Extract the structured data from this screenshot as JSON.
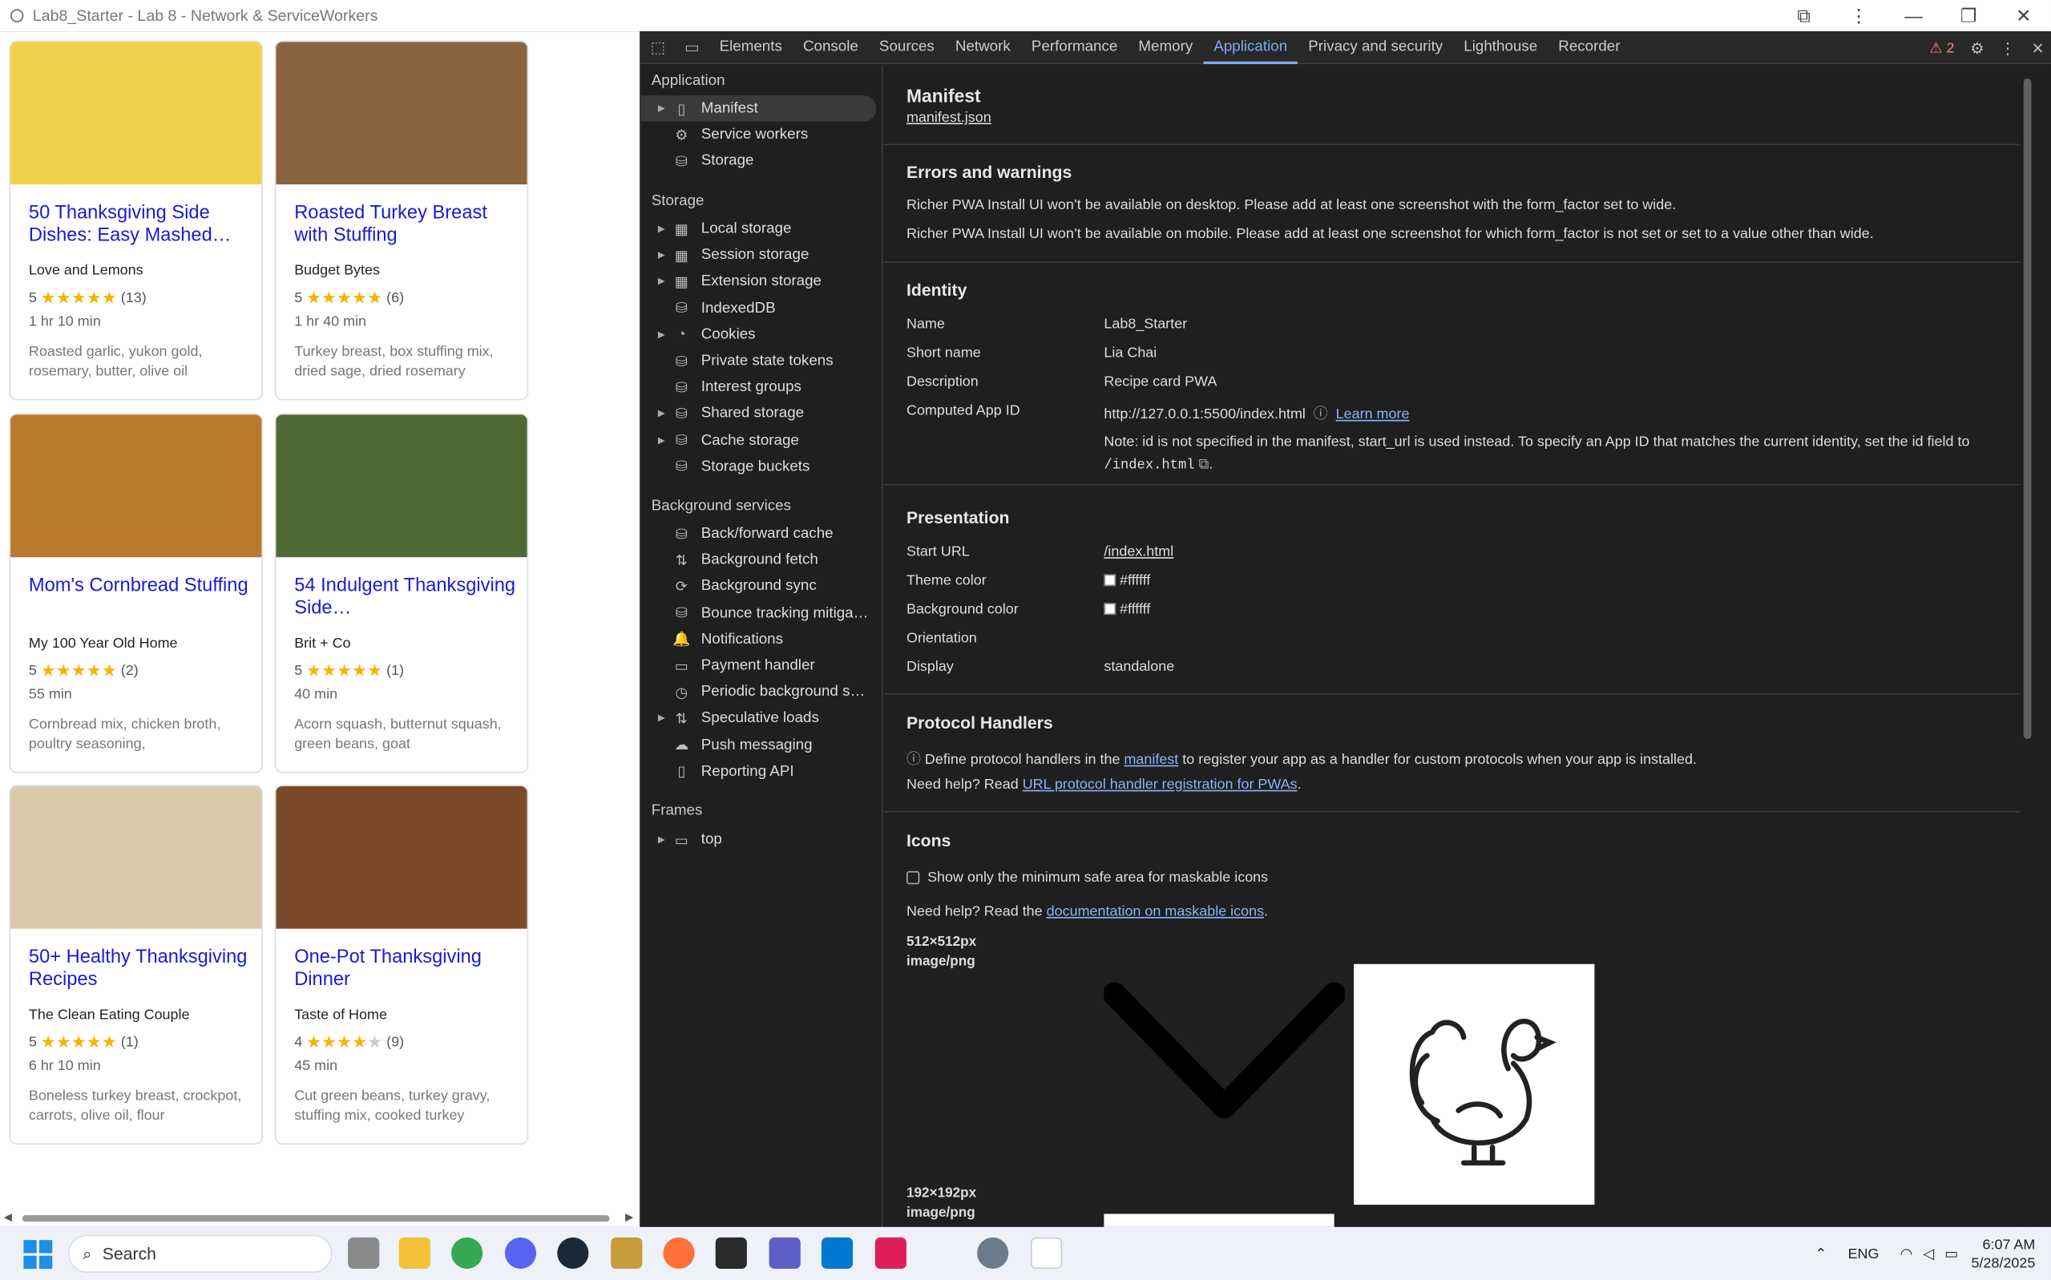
{
  "window": {
    "title": "Lab8_Starter - Lab 8 - Network & ServiceWorkers"
  },
  "recipes": [
    {
      "title": "50 Thanksgiving Side Dishes: Easy Mashed…",
      "source": "Love and Lemons",
      "rating_num": "5",
      "stars": 5,
      "reviews": "(13)",
      "time": "1 hr 10 min",
      "ingredients": "Roasted garlic, yukon gold, rosemary, butter, olive oil",
      "img_color": "#f0d24a"
    },
    {
      "title": "Roasted Turkey Breast with Stuffing",
      "source": "Budget Bytes",
      "rating_num": "5",
      "stars": 5,
      "reviews": "(6)",
      "time": "1 hr 40 min",
      "ingredients": "Turkey breast, box stuffing mix, dried sage, dried rosemary",
      "img_color": "#8a6440"
    },
    {
      "title": "Mom's Cornbread Stuffing",
      "source": "My 100 Year Old Home",
      "rating_num": "5",
      "stars": 5,
      "reviews": "(2)",
      "time": "55 min",
      "ingredients": "Cornbread mix, chicken broth, poultry seasoning,",
      "img_color": "#b97a2e"
    },
    {
      "title": "54 Indulgent Thanksgiving Side…",
      "source": "Brit + Co",
      "rating_num": "5",
      "stars": 5,
      "reviews": "(1)",
      "time": "40 min",
      "ingredients": "Acorn squash, butternut squash, green beans, goat",
      "img_color": "#4d6a34"
    },
    {
      "title": "50+ Healthy Thanksgiving Recipes",
      "source": "The Clean Eating Couple",
      "rating_num": "5",
      "stars": 5,
      "reviews": "(1)",
      "time": "6 hr 10 min",
      "ingredients": "Boneless turkey breast, crockpot, carrots, olive oil, flour",
      "img_color": "#d8c9a8"
    },
    {
      "title": "One-Pot Thanksgiving Dinner",
      "source": "Taste of Home",
      "rating_num": "4",
      "stars": 4,
      "reviews": "(9)",
      "time": "45 min",
      "ingredients": "Cut green beans, turkey gravy, stuffing mix, cooked turkey",
      "img_color": "#7a4a2a"
    }
  ],
  "devtools": {
    "tabs": [
      "Elements",
      "Console",
      "Sources",
      "Network",
      "Performance",
      "Memory",
      "Application",
      "Privacy and security",
      "Lighthouse",
      "Recorder"
    ],
    "active_tab": "Application",
    "warnings_count": "2",
    "sidebar": {
      "application_header": "Application",
      "application_items": [
        "Manifest",
        "Service workers",
        "Storage"
      ],
      "storage_header": "Storage",
      "storage_items": [
        "Local storage",
        "Session storage",
        "Extension storage",
        "IndexedDB",
        "Cookies",
        "Private state tokens",
        "Interest groups",
        "Shared storage",
        "Cache storage",
        "Storage buckets"
      ],
      "bg_header": "Background services",
      "bg_items": [
        "Back/forward cache",
        "Background fetch",
        "Background sync",
        "Bounce tracking mitigati…",
        "Notifications",
        "Payment handler",
        "Periodic background sync",
        "Speculative loads",
        "Push messaging",
        "Reporting API"
      ],
      "frames_header": "Frames",
      "frames_items": [
        "top"
      ]
    },
    "manifest": {
      "title": "Manifest",
      "file_link": "manifest.json",
      "errors_header": "Errors and warnings",
      "error1": "Richer PWA Install UI won’t be available on desktop. Please add at least one screenshot with the form_factor set to wide.",
      "error2": "Richer PWA Install UI won’t be available on mobile. Please add at least one screenshot for which form_factor is not set or set to a value other than wide.",
      "identity_header": "Identity",
      "name_label": "Name",
      "name_value": "Lab8_Starter",
      "short_name_label": "Short name",
      "short_name_value": "Lia Chai",
      "description_label": "Description",
      "description_value": "Recipe card PWA",
      "app_id_label": "Computed App ID",
      "app_id_value": "http://127.0.0.1:5500/index.html",
      "learn_more": "Learn more",
      "note": "Note: id is not specified in the manifest, start_url is used instead. To specify an App ID that matches the current identity, set the id field to",
      "note_code": "/index.html",
      "presentation_header": "Presentation",
      "start_url_label": "Start URL",
      "start_url_value": "/index.html",
      "theme_label": "Theme color",
      "theme_value": "#ffffff",
      "bg_label": "Background color",
      "bg_value": "#ffffff",
      "orientation_label": "Orientation",
      "orientation_value": "",
      "display_label": "Display",
      "display_value": "standalone",
      "protocol_header": "Protocol Handlers",
      "protocol_text1": "Define protocol handlers in the",
      "protocol_link": "manifest",
      "protocol_text2": "to register your app as a handler for custom protocols when your app is installed.",
      "help1_text": "Need help? Read",
      "help1_link": "URL protocol handler registration for PWAs",
      "icons_header": "Icons",
      "maskable_checkbox": "Show only the minimum safe area for maskable icons",
      "help2_text": "Need help? Read the",
      "help2_link": "documentation on maskable icons",
      "icon1_size": "512×512px",
      "icon1_type": "image/png",
      "icon2_size": "192×192px",
      "icon2_type": "image/png"
    }
  },
  "taskbar": {
    "search_placeholder": "Search",
    "lang": "ENG",
    "time": "6:07 AM",
    "date": "5/28/2025"
  }
}
